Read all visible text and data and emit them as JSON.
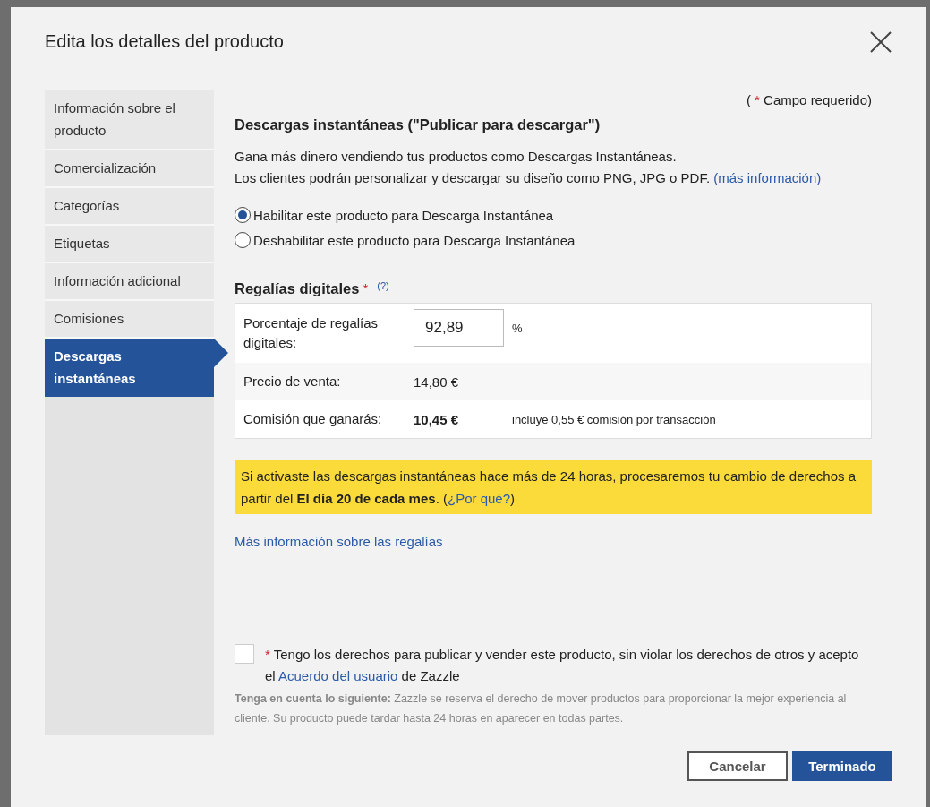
{
  "dialog": {
    "title": "Edita los detalles del producto"
  },
  "sidebar": {
    "items": [
      {
        "label": "Información sobre el producto",
        "selected": false
      },
      {
        "label": "Comercialización",
        "selected": false
      },
      {
        "label": "Categorías",
        "selected": false
      },
      {
        "label": "Etiquetas",
        "selected": false
      },
      {
        "label": "Información adicional",
        "selected": false
      },
      {
        "label": "Comisiones",
        "selected": false
      },
      {
        "label": "Descargas instantáneas",
        "selected": true
      }
    ]
  },
  "content": {
    "required_note": {
      "open": "(",
      "asterisk": "*",
      "text": "Campo requerido)"
    },
    "section_title": "Descargas instantáneas (\"Publicar para descargar\")",
    "description": [
      "Gana más dinero vendiendo tus productos como Descargas Instantáneas.",
      "Los clientes podrán personalizar y descargar su diseño como PNG, JPG o PDF."
    ],
    "more_info_link": "(más información)",
    "radios": [
      {
        "label": "Habilitar este producto para Descarga Instantánea",
        "selected": true
      },
      {
        "label": "Deshabilitar este producto para Descarga Instantánea",
        "selected": false
      }
    ],
    "royalties": {
      "title": "Regalías digitales",
      "asterisk": "*",
      "help": "(?)",
      "rows": [
        {
          "kind": "input",
          "label": "Porcentaje de regalías digitales:",
          "value": "92,89",
          "unit": "%"
        },
        {
          "kind": "text",
          "label": "Precio de venta:",
          "value": "14,80 €"
        },
        {
          "kind": "earnings",
          "label": "Comisión que ganarás:",
          "value": "10,45 €",
          "note": "incluye 0,55 € comisión por transacción"
        }
      ]
    },
    "notice": {
      "text": "Si activaste las descargas instantáneas hace más de 24 horas, procesaremos tu cambio de derechos a partir del **El día 20 de cada mes**. (",
      "link": "¿Por qué?",
      "after": ")"
    },
    "royalties_link": "Más información sobre las regalías",
    "agreement": {
      "checked": false,
      "asterisk": "*",
      "text": "Tengo los derechos para publicar y vender este producto, sin violar los derechos de otros y acepto el",
      "link": "Acuerdo del usuario",
      "after": "de Zazzle"
    },
    "note": "**Tenga en cuenta lo siguiente:** Zazzle se reserva el derecho de mover productos para proporcionar la mejor experiencia al cliente. Su producto puede tardar hasta 24 horas en aparecer en todas partes."
  },
  "buttons": [
    {
      "label": "Cancelar",
      "kind": "secondary"
    },
    {
      "label": "Terminado",
      "kind": "primary"
    }
  ]
}
